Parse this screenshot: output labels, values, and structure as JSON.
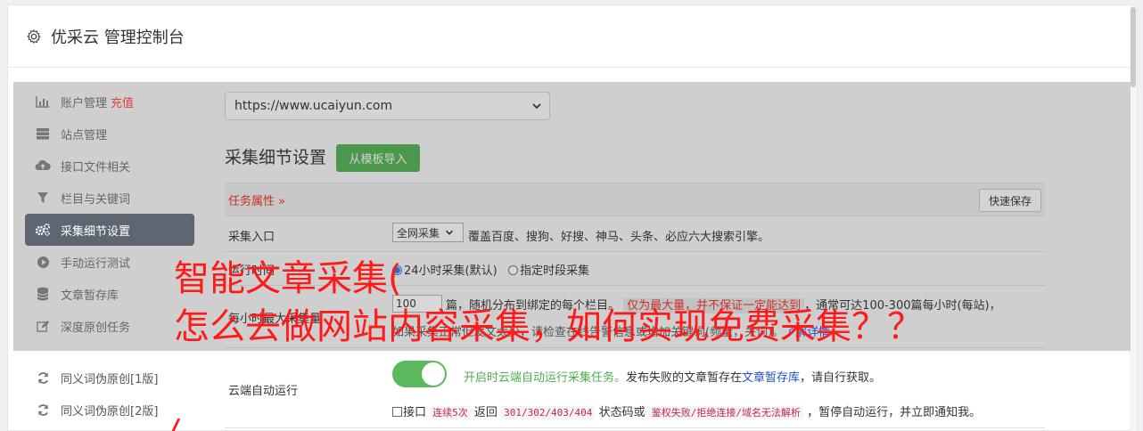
{
  "header": {
    "title": "优采云 管理控制台",
    "icon": "gear-icon"
  },
  "sidebar": {
    "items": [
      {
        "label": "账户管理",
        "badge": "充值",
        "icon": "bar-chart-icon"
      },
      {
        "label": "站点管理",
        "icon": "server-icon"
      },
      {
        "label": "接口文件相关",
        "icon": "cloud-upload-icon"
      },
      {
        "label": "栏目与关键词",
        "icon": "filter-icon"
      },
      {
        "label": "采集细节设置",
        "icon": "gears-icon",
        "active": true
      },
      {
        "label": "手动运行测试",
        "icon": "play-circle-icon"
      },
      {
        "label": "文章暂存库",
        "icon": "database-icon"
      },
      {
        "label": "深度原创任务",
        "icon": "edit-icon"
      },
      {
        "label": "同义词伪原创[1版]",
        "icon": "refresh-icon"
      },
      {
        "label": "同义词伪原创[2版]",
        "icon": "refresh-icon"
      }
    ]
  },
  "site_select": {
    "value": "https://www.ucaiyun.com"
  },
  "section": {
    "title": "采集细节设置",
    "template_button": "从模板导入"
  },
  "table": {
    "task_attr": "任务属性 »",
    "quick_save": "快速保存",
    "rows": {
      "entry": {
        "label": "采集入口",
        "select_value": "全网采集",
        "desc": "覆盖百度、搜狗、好搜、神马、头条、必应六大搜索引擎。"
      },
      "run_time": {
        "label": "运行时间",
        "option1": "24小时采集(默认)",
        "option2": "指定时段采集"
      },
      "max_per_hour": {
        "label": "每小时最大采集量",
        "value": "100",
        "text1": "篇，随机分布到绑定的每个栏目。",
        "note": "仅为最大量，并不保证一定能达到",
        "text2": "，通常可达100-300篇每小时(每站)，",
        "line2": "如果采集正常但发文太少，请检查在线告警信息或增加关键词(频量，关词)。",
        "line2_link": "了解详情"
      },
      "cloud_run": {
        "label": "云端自动运行",
        "toggle_on": true,
        "text_green": "开启时云端自动运行采集任务。",
        "text_mid": "发布失败的文章暂存在",
        "link": "文章暂存库",
        "text_end": "，请自行获取。",
        "cb_label": "接口",
        "code1": "连续5次",
        "text_a": "返回",
        "code2": "301/302/403/404",
        "text_b": "状态码或",
        "code3": "鉴权失败/拒绝连接/域名无法解析",
        "text_c": "，暂停自动运行，并立即通知我。"
      }
    }
  },
  "overlay": {
    "line1": "智能文章采集(",
    "line2": "怎么去做网站内容采集，如何实现免费采集？？"
  },
  "colors": {
    "accent_green": "#5cb85c",
    "active_sidebar": "#5d6671",
    "overlay_red": "#ff1a1a"
  }
}
